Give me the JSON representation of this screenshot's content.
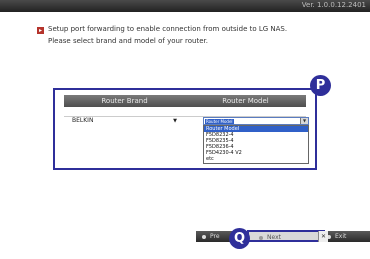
{
  "header": {
    "version": "Ver. 1.0.0.12.2401"
  },
  "intro": {
    "icon": "info-square-icon",
    "line1": "Setup port forwarding to enable connection from outside to LG NAS.",
    "line2": "Please select brand and model of your router."
  },
  "table": {
    "col_brand": "Router Brand",
    "col_model": "Router Model",
    "brand_value": "BELKIN",
    "model_value": "Router Model",
    "model_options": [
      "Router Model",
      "F5D8232-4",
      "F5D8235-4",
      "F5D8236-4",
      "F5D4230-4 V2",
      "etc"
    ]
  },
  "annotations": {
    "p": "P",
    "q": "Q"
  },
  "footer": {
    "prev": "Pre",
    "next": "Next",
    "exit": "Exit"
  },
  "colors": {
    "highlight": "#2f2f9a",
    "selection": "#3060c8"
  }
}
